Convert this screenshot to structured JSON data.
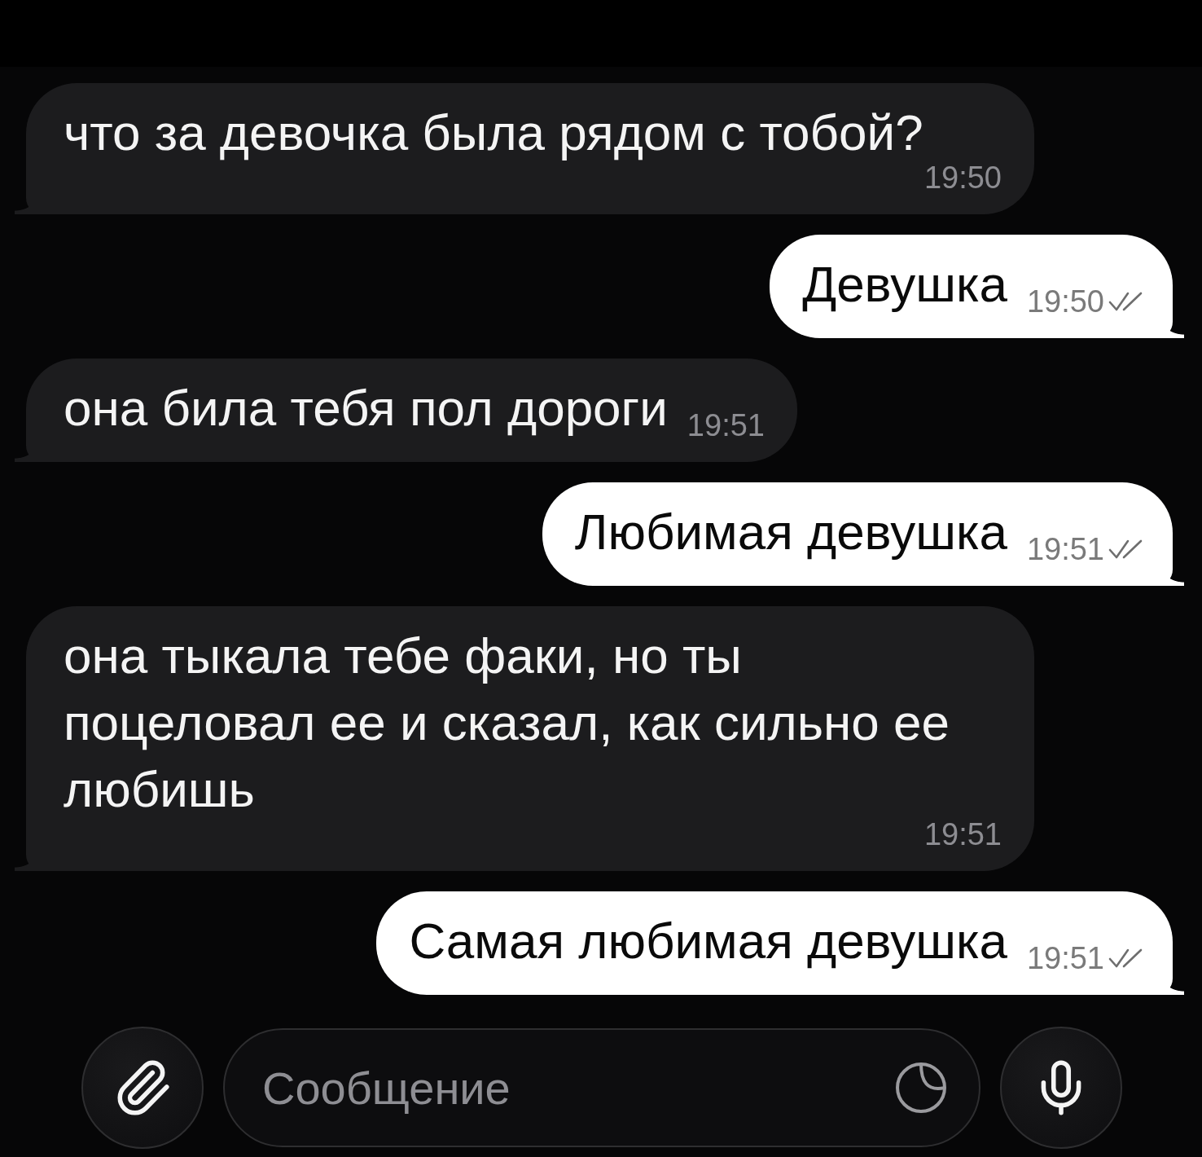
{
  "messages": [
    {
      "kind": "incoming",
      "text": "что за девочка была рядом с тобой?",
      "time": "19:50"
    },
    {
      "kind": "outgoing",
      "text": "Девушка",
      "time": "19:50",
      "read": true
    },
    {
      "kind": "incoming",
      "text": "она била тебя пол дороги",
      "time": "19:51"
    },
    {
      "kind": "outgoing",
      "text": "Любимая девушка",
      "time": "19:51",
      "read": true
    },
    {
      "kind": "incoming",
      "text": "она тыкала тебе факи, но ты поцеловал ее и сказал, как сильно ее любишь",
      "time": "19:51"
    },
    {
      "kind": "outgoing",
      "text": "Самая любимая девушка",
      "time": "19:51",
      "read": true
    }
  ],
  "composer": {
    "placeholder": "Сообщение"
  }
}
